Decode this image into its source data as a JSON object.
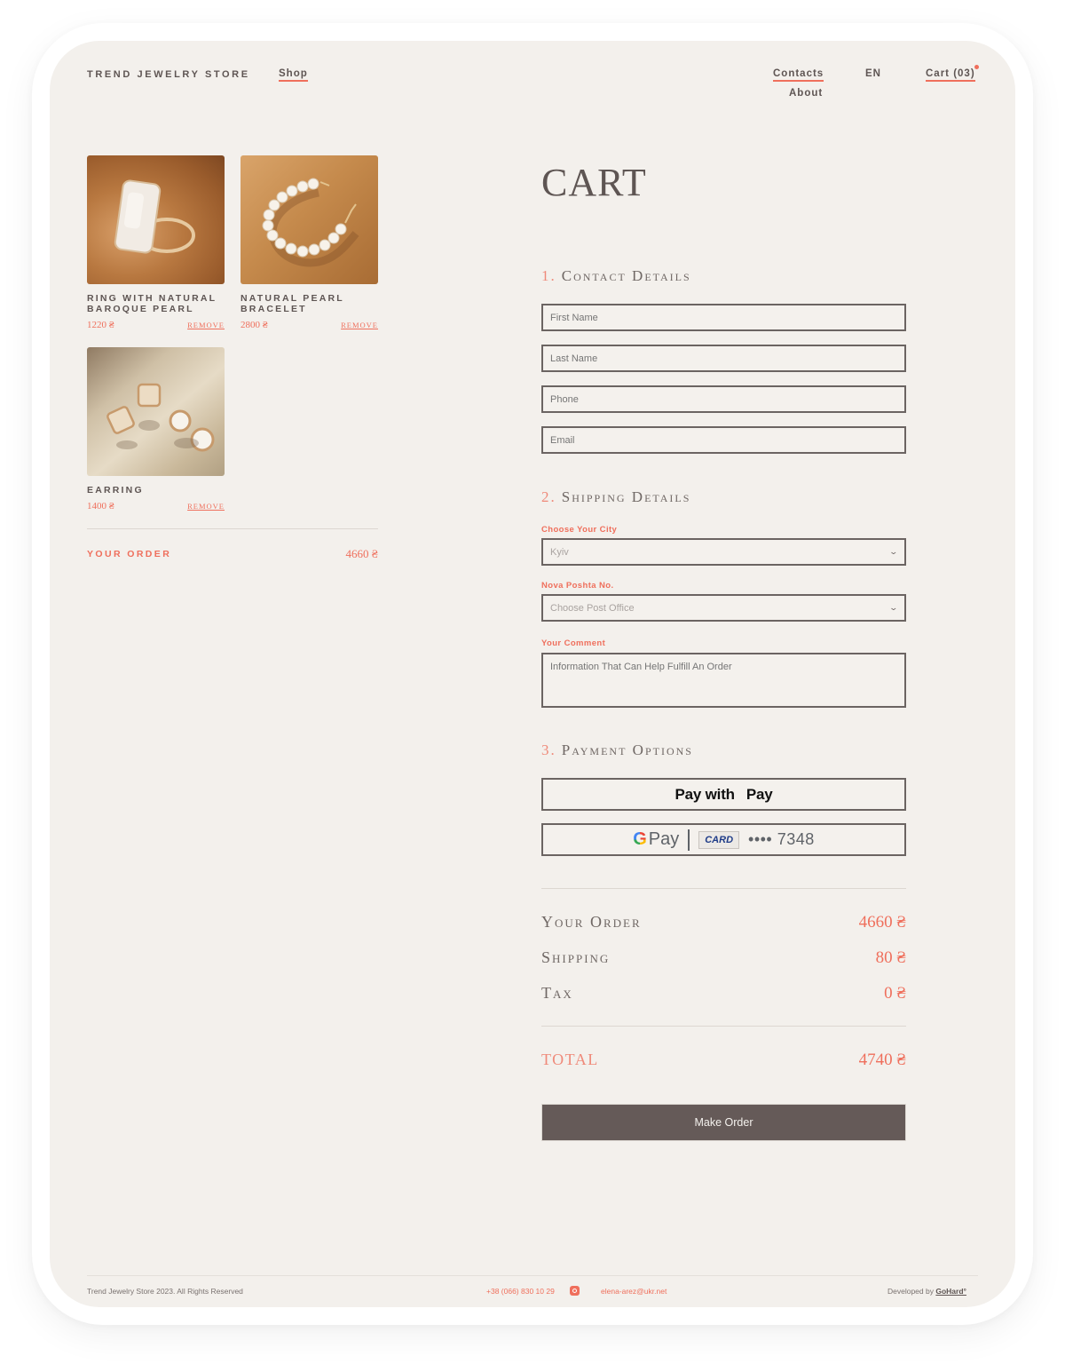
{
  "header": {
    "brand": "TREND JEWELRY STORE",
    "nav": {
      "shop": "Shop",
      "contacts": "Contacts",
      "about": "About",
      "language": "EN",
      "cart": "Cart (03)"
    }
  },
  "cart_items": [
    {
      "name": "Ring with natural baroque pearl",
      "price": "1220 ₴",
      "remove_label": "Remove",
      "image": "pearl-ring-photo"
    },
    {
      "name": "Natural pearl bracelet",
      "price": "2800 ₴",
      "remove_label": "Remove",
      "image": "pearl-bracelet-photo"
    },
    {
      "name": "Earring",
      "price": "1400 ₴",
      "remove_label": "Remove",
      "image": "earrings-photo"
    }
  ],
  "left_summary": {
    "label": "YOUR ORDER",
    "value": "4660 ₴"
  },
  "page_title": "CART",
  "sections": {
    "contact": {
      "number": "1.",
      "title": "Contact Details"
    },
    "shipping": {
      "number": "2.",
      "title": "Shipping Details"
    },
    "payment": {
      "number": "3.",
      "title": "Payment Options"
    }
  },
  "contact_fields": {
    "first_name": {
      "placeholder": "First Name",
      "value": ""
    },
    "last_name": {
      "placeholder": "Last Name",
      "value": ""
    },
    "phone": {
      "placeholder": "Phone",
      "value": ""
    },
    "email": {
      "placeholder": "Email",
      "value": ""
    }
  },
  "shipping_fields": {
    "city": {
      "label": "Choose Your City",
      "selected": "Kyiv"
    },
    "post_office": {
      "label": "Nova Poshta No.",
      "selected": "Choose Post Office"
    },
    "comment": {
      "label": "Your Comment",
      "placeholder": "Information That Can Help Fulfill An Order",
      "value": ""
    }
  },
  "payment": {
    "apple_pay": {
      "prefix": "Pay with",
      "brand": "Pay"
    },
    "google_pay": {
      "g": "G",
      "brand": "Pay",
      "card_badge": "CARD",
      "card_number": "•••• 7348"
    }
  },
  "summary": {
    "rows": [
      {
        "label": "Your Order",
        "value": "4660 ₴"
      },
      {
        "label": "Shipping",
        "value": "80 ₴"
      },
      {
        "label": "Tax",
        "value": "0 ₴"
      }
    ],
    "total": {
      "label": "TOTAL",
      "value": "4740 ₴"
    }
  },
  "make_order_label": "Make Order",
  "footer": {
    "copyright": "Trend Jewelry Store 2023. All Rights Reserved",
    "phone": "+38 (066) 830 10 29",
    "email": "elena-arez@ukr.net",
    "developed_by": "Developed by",
    "developer": "GoHard°"
  },
  "colors": {
    "accent": "#ef6f5c",
    "background": "#f3f0ec",
    "text": "#5e5553",
    "button": "#655a58"
  }
}
